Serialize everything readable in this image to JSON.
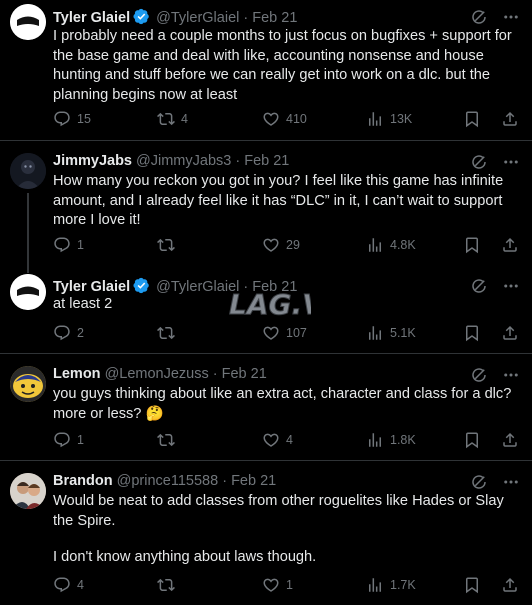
{
  "tweets": [
    {
      "name": "Tyler Glaiel",
      "handle": "@TylerGlaiel",
      "time": "Feb 21",
      "verified": true,
      "text": "I probably need a couple months to just focus on bugfixes + support for the base game and deal with like, accounting nonsense and house hunting and stuff before we can really get into work on a dlc. but the planning begins now at least",
      "replies": "15",
      "retweets": "4",
      "likes": "410",
      "views": "13K"
    },
    {
      "name": "JimmyJabs",
      "handle": "@JimmyJabs3",
      "time": "Feb 21",
      "verified": false,
      "text": "How many you reckon you got in you? I feel like this game has infinite amount, and I already feel like it has “DLC” in it, I can’t wait to support more I love it!",
      "replies": "1",
      "retweets": "",
      "likes": "29",
      "views": "4.8K"
    },
    {
      "name": "Tyler Glaiel",
      "handle": "@TylerGlaiel",
      "time": "Feb 21",
      "verified": true,
      "text": "at least 2",
      "replies": "2",
      "retweets": "",
      "likes": "107",
      "views": "5.1K"
    },
    {
      "name": "Lemon",
      "handle": "@LemonJezuss",
      "time": "Feb 21",
      "verified": false,
      "text": "you guys thinking about like an extra act, character and class for a dlc? more or less? 🤔",
      "replies": "1",
      "retweets": "",
      "likes": "4",
      "views": "1.8K"
    },
    {
      "name": "Brandon",
      "handle": "@prince115588",
      "time": "Feb 21",
      "verified": false,
      "text_lines": [
        "Would be neat to add classes from other roguelites like Hades or Slay the Spire.",
        "I don't know anything about laws though."
      ],
      "replies": "4",
      "retweets": "",
      "likes": "1",
      "views": "1.7K"
    }
  ],
  "separator": " · ",
  "watermark": "LAG.VN",
  "colors": {
    "accent": "#1d9bf0",
    "muted": "#71767b",
    "text": "#e7e9ea",
    "border": "#2f3336"
  },
  "icons": [
    "grok-icon",
    "more-icon",
    "reply-icon",
    "retweet-icon",
    "like-icon",
    "views-icon",
    "bookmark-icon",
    "share-icon",
    "verified-icon"
  ]
}
